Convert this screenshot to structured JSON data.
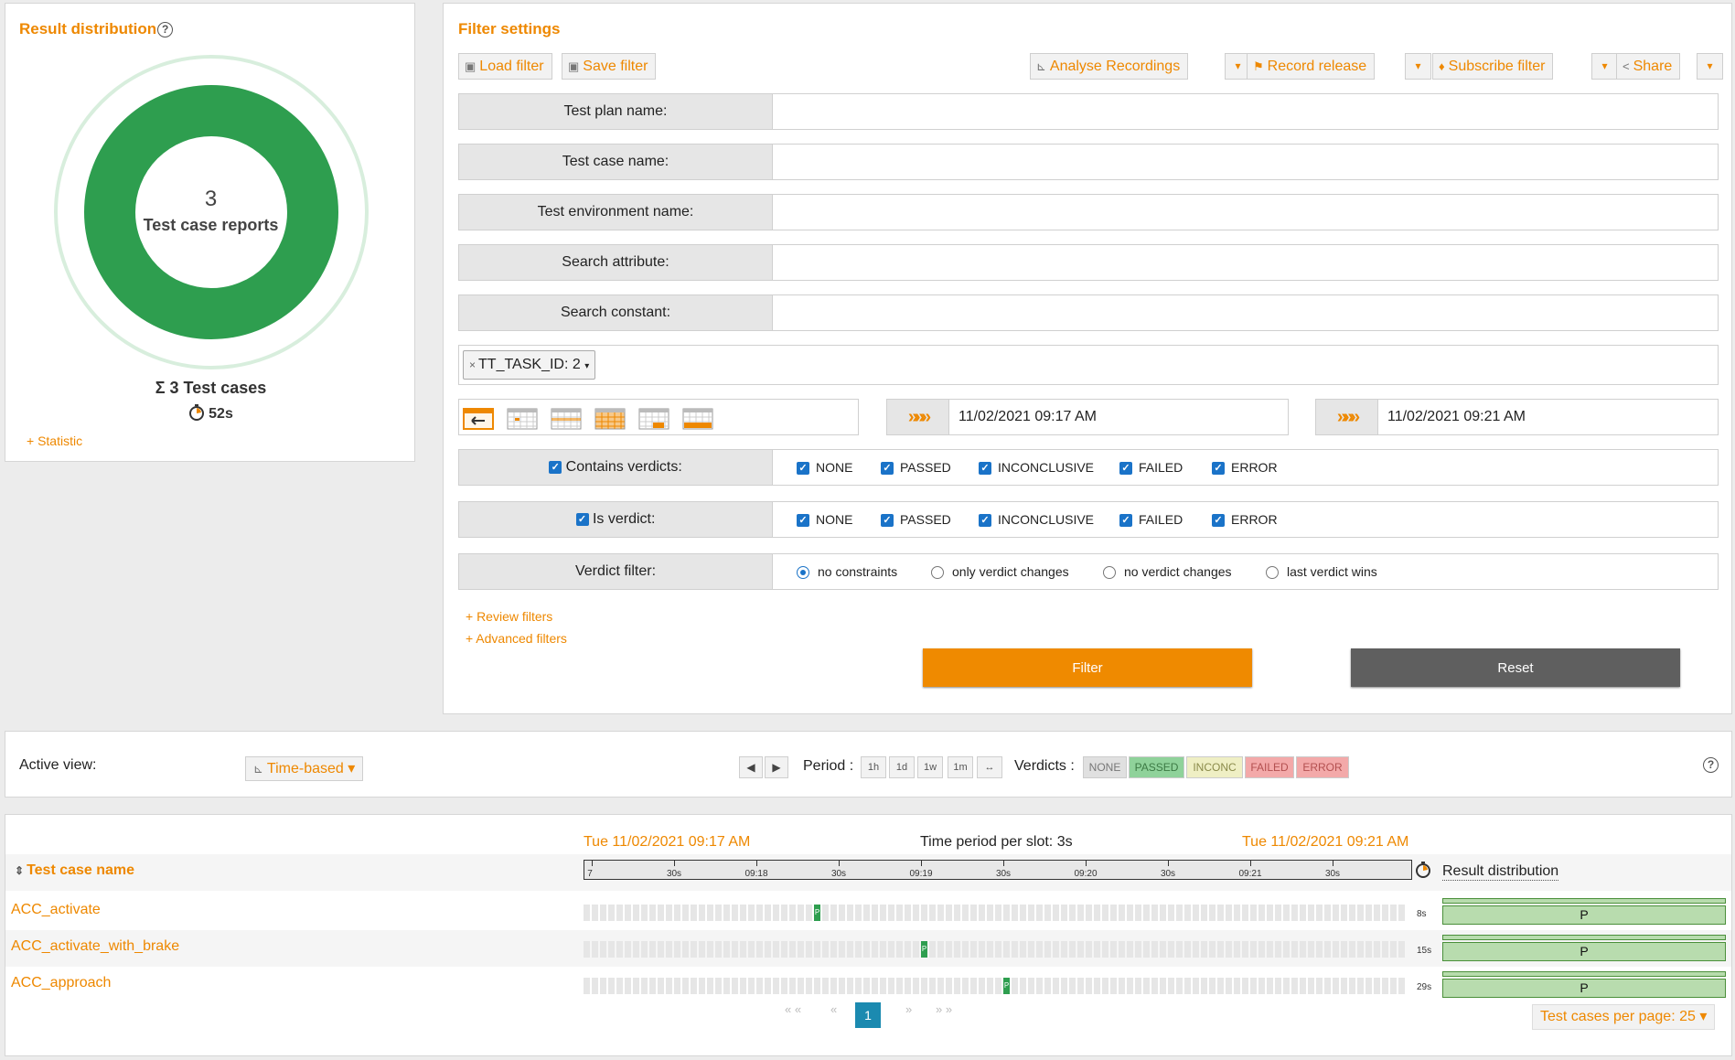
{
  "dist": {
    "title": "Result distribution",
    "help": "?",
    "count": "3",
    "count_label": "Test case reports",
    "sum_label": "Σ 3 Test cases",
    "duration": "52s",
    "statistic_link": "+ Statistic",
    "colors": {
      "passed": "#2e9e4f",
      "ring": "#d8eedd"
    }
  },
  "filter": {
    "title": "Filter settings",
    "load": "Load filter",
    "save": "Save filter",
    "analyse": "Analyse Recordings",
    "record": "Record release",
    "subscribe": "Subscribe filter",
    "share": "Share",
    "caret": "▾",
    "fields": [
      {
        "label": "Test plan name:",
        "value": ""
      },
      {
        "label": "Test case name:",
        "value": ""
      },
      {
        "label": "Test environment name:",
        "value": ""
      },
      {
        "label": "Search attribute:",
        "value": ""
      },
      {
        "label": "Search constant:",
        "value": ""
      }
    ],
    "tag": "TT_TASK_ID: 2",
    "tag_remove": "×",
    "tag_caret": "▾",
    "date_arrow": "»»»",
    "date_from": "11/02/2021 09:17 AM",
    "date_to": "11/02/2021 09:21 AM",
    "contains_label": "Contains verdicts:",
    "is_label": "Is verdict:",
    "verdict_options": [
      "NONE",
      "PASSED",
      "INCONCLUSIVE",
      "FAILED",
      "ERROR"
    ],
    "vfilter_label": "Verdict filter:",
    "vfilter_options": [
      "no constraints",
      "only verdict changes",
      "no verdict changes",
      "last verdict wins"
    ],
    "review_link": "+ Review filters",
    "advanced_link": "+ Advanced filters",
    "filter_btn": "Filter",
    "reset_btn": "Reset",
    "check": "✓"
  },
  "view": {
    "active_label": "Active view:",
    "mode": "Time-based ▾",
    "prev": "◀",
    "next": "▶",
    "period_label": "Period :",
    "periods": [
      "1h",
      "1d",
      "1w",
      "1m",
      "↔"
    ],
    "verdicts_label": "Verdicts :",
    "verdicts": [
      "NONE",
      "PASSED",
      "INCONC",
      "FAILED",
      "ERROR"
    ],
    "verdict_colors": [
      "#e0e0e0",
      "#8fd29a",
      "#efefc4",
      "#f3a9a9",
      "#f3a9a9"
    ],
    "help": "?"
  },
  "table": {
    "start": "Tue 11/02/2021 09:17 AM",
    "slot_label": "Time period per slot: 3s",
    "end": "Tue 11/02/2021 09:21 AM",
    "col_name": "Test case name",
    "col_dist": "Result distribution",
    "sort_icon": "⇕",
    "ticks": [
      "7",
      "30s",
      "09:18",
      "30s",
      "09:19",
      "30s",
      "09:20",
      "30s",
      "09:21",
      "30s"
    ],
    "rows": [
      {
        "name": "ACC_activate",
        "duration": "8s",
        "slot": 28,
        "result": "P",
        "slot_mark": "P"
      },
      {
        "name": "ACC_activate_with_brake",
        "duration": "15s",
        "slot": 41,
        "result": "P",
        "slot_mark": "P"
      },
      {
        "name": "ACC_approach",
        "duration": "29s",
        "slot": 51,
        "result": "P",
        "slot_mark": "P"
      }
    ],
    "pager_first": "« «",
    "pager_prev": "«",
    "page": "1",
    "pager_next": "»",
    "pager_last": "» »",
    "per_page": "Test cases per page: 25 ▾"
  }
}
